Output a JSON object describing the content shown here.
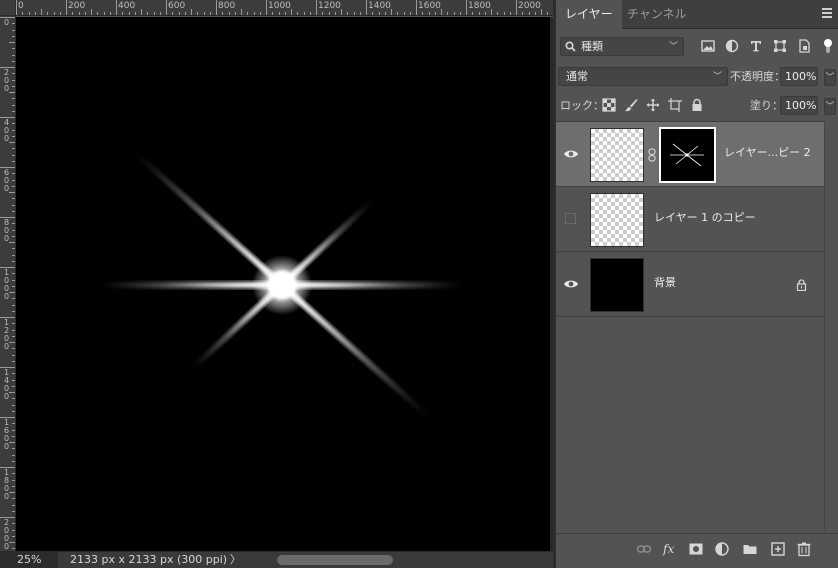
{
  "canvas": {
    "ruler_top_labels": [
      "0",
      "200",
      "400",
      "600",
      "800",
      "1000",
      "1200",
      "1400",
      "1600",
      "1800",
      "2000"
    ],
    "ruler_left_labels": [
      "0",
      "200",
      "400",
      "600",
      "800",
      "1000",
      "1200",
      "1400",
      "1600",
      "1800",
      "2000"
    ]
  },
  "status": {
    "zoom": "25%",
    "doc_info": "2133 px x 2133 px (300 ppi)",
    "chevron": "〉"
  },
  "panel": {
    "tabs": [
      {
        "label": "レイヤー",
        "active": true
      },
      {
        "label": "チャンネル",
        "active": false
      }
    ],
    "filter": {
      "label": "種類",
      "icons": [
        "image-filter-icon",
        "adjustment-filter-icon",
        "type-filter-icon",
        "shape-filter-icon",
        "smart-object-filter-icon",
        "filter-toggle-icon"
      ]
    },
    "blend_mode": "通常",
    "opacity_label": "不透明度：",
    "opacity_value": "100%",
    "lock_label": "ロック：",
    "lock_icons": [
      "lock-transparent-pixels-icon",
      "lock-image-pixels-icon",
      "lock-position-icon",
      "lock-artboard-icon",
      "lock-all-icon"
    ],
    "fill_label": "塗り：",
    "fill_value": "100%",
    "layers": [
      {
        "name": "レイヤー...ピー 2",
        "visible": true,
        "selected": true,
        "has_mask": true,
        "thumb": "transparent"
      },
      {
        "name": "レイヤー 1 のコピー",
        "visible": false,
        "selected": false,
        "has_mask": false,
        "thumb": "transparent"
      },
      {
        "name": "背景",
        "visible": true,
        "selected": false,
        "has_mask": false,
        "thumb": "black",
        "locked": true
      }
    ],
    "bottom_icons": [
      "link-layers-icon",
      "fx-icon",
      "add-mask-icon",
      "adjustment-layer-icon",
      "new-group-icon",
      "new-layer-icon",
      "delete-layer-icon"
    ]
  },
  "colors": {
    "canvas_bg": "#000000",
    "panel_bg": "#535353",
    "selected_row": "#6e6e6e"
  }
}
